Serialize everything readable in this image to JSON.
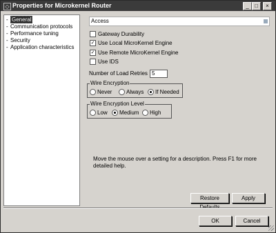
{
  "window": {
    "title": "Properties for Microkernel Router",
    "minimize_glyph": "_",
    "maximize_glyph": "□",
    "close_glyph": "×"
  },
  "tree": {
    "items": [
      {
        "label": "General",
        "selected": true
      },
      {
        "label": "Communication protocols",
        "selected": false
      },
      {
        "label": "Performance tuning",
        "selected": false
      },
      {
        "label": "Security",
        "selected": false
      },
      {
        "label": "Application characteristics",
        "selected": false
      }
    ]
  },
  "section": {
    "title": "Access"
  },
  "checkboxes": [
    {
      "label": "Gateway Durability",
      "checked": false
    },
    {
      "label": "Use Local MicroKernel Engine",
      "checked": true
    },
    {
      "label": "Use Remote MicroKernel Engine",
      "checked": true
    },
    {
      "label": "Use IDS",
      "checked": false
    }
  ],
  "retries": {
    "label": "Number of Load Retries",
    "value": "5"
  },
  "wire_encryption": {
    "legend": "Wire Encryption",
    "options": [
      "Never",
      "Always",
      "If Needed"
    ],
    "selected": "If Needed"
  },
  "encryption_level": {
    "legend": "Wire Encryption Level",
    "options": [
      "Low",
      "Medium",
      "High"
    ],
    "selected": "Medium"
  },
  "description": "Move the mouse over a setting for a description. Press F1 for more detailed help.",
  "buttons": {
    "restore": "Restore Defaults",
    "apply": "Apply",
    "ok": "OK",
    "cancel": "Cancel"
  },
  "check_glyph": "✓"
}
